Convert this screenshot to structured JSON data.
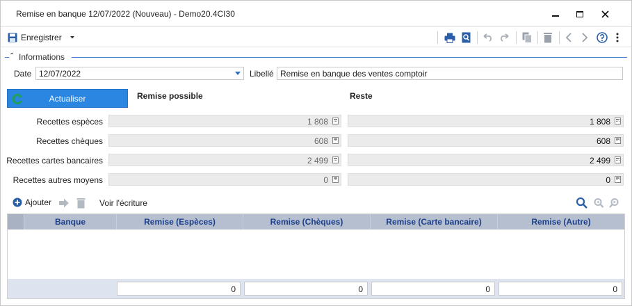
{
  "window": {
    "title": "Remise en banque 12/07/2022 (Nouveau) - Demo20.4CI30",
    "controls": {
      "minimize": "minimize-icon",
      "maximize": "maximize-icon",
      "close": "close-icon"
    }
  },
  "toolbar": {
    "save_label": "Enregistrer",
    "icons": [
      "save-icon",
      "dropdown-caret-icon",
      "print-icon",
      "preview-icon",
      "undo-icon",
      "redo-icon",
      "copy-icon",
      "delete-icon",
      "prev-icon",
      "next-icon",
      "help-icon",
      "more-icon"
    ]
  },
  "section": {
    "label": "Informations"
  },
  "form": {
    "date_label": "Date",
    "date_value": "12/07/2022",
    "libelle_label": "Libellé",
    "libelle_value": "Remise en banque des ventes comptoir"
  },
  "actions": {
    "actualiser_label": "Actualiser"
  },
  "columns": {
    "remise_possible": "Remise possible",
    "reste": "Reste"
  },
  "rows": [
    {
      "label": "Recettes espèces",
      "possible": "1 808",
      "reste": "1 808"
    },
    {
      "label": "Recettes chèques",
      "possible": "608",
      "reste": "608"
    },
    {
      "label": "Recettes cartes bancaires",
      "possible": "2 499",
      "reste": "2 499"
    },
    {
      "label": "Recettes autres moyens",
      "possible": "0",
      "reste": "0"
    }
  ],
  "grid_toolbar": {
    "ajouter_label": "Ajouter",
    "voir_label": "Voir l'écriture"
  },
  "grid": {
    "headers": [
      "Banque",
      "Remise (Espèces)",
      "Remise (Chèques)",
      "Remise (Carte bancaire)",
      "Remise (Autre)"
    ],
    "totals": [
      "0",
      "0",
      "0",
      "0"
    ]
  },
  "colors": {
    "accent": "#2a86e0",
    "header_text": "#1d3f8a",
    "grid_header_bg": "#b5bfcf"
  }
}
